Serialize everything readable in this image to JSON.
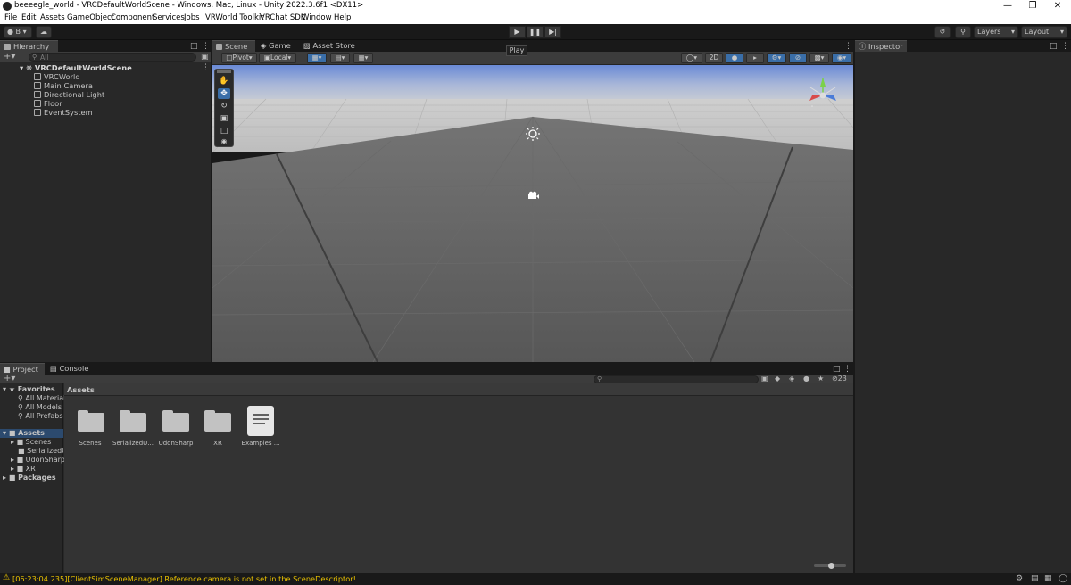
{
  "window": {
    "title": "beeeegle_world - VRCDefaultWorldScene - Windows, Mac, Linux - Unity 2022.3.6f1 <DX11>"
  },
  "menu": [
    "File",
    "Edit",
    "Assets",
    "GameObject",
    "Component",
    "Services",
    "Jobs",
    "VRWorld Toolkit",
    "VRChat SDK",
    "Window",
    "Help"
  ],
  "toolbar": {
    "account_label": "B",
    "play_tooltip": "Play",
    "layers_label": "Layers",
    "layout_label": "Layout"
  },
  "hierarchy": {
    "tab_label": "Hierarchy",
    "search_placeholder": "All",
    "scene_name": "VRCDefaultWorldScene",
    "items": [
      "VRCWorld",
      "Main Camera",
      "Directional Light",
      "Floor",
      "EventSystem"
    ]
  },
  "scene_tabs": [
    "Scene",
    "Game",
    "Asset Store"
  ],
  "scene_toolbar": {
    "pivot_label": "Pivot",
    "local_label": "Local",
    "mode_2d": "2D"
  },
  "inspector": {
    "tab_label": "Inspector"
  },
  "project": {
    "tabs": [
      "Project",
      "Console"
    ],
    "favorites_label": "Favorites",
    "favorites": [
      "All Materials",
      "All Models",
      "All Prefabs"
    ],
    "assets_label": "Assets",
    "asset_tree": [
      "Scenes",
      "SerializedUdonPrograms",
      "UdonSharp",
      "XR"
    ],
    "packages_label": "Packages",
    "breadcrumb": "Assets",
    "hidden_count": "23",
    "grid": [
      {
        "label": "Scenes",
        "kind": "folder"
      },
      {
        "label": "SerializedU...",
        "kind": "folder"
      },
      {
        "label": "UdonSharp",
        "kind": "folder"
      },
      {
        "label": "XR",
        "kind": "folder"
      },
      {
        "label": "Examples ...",
        "kind": "document"
      }
    ]
  },
  "status": {
    "message": "[06:23:04.235][ClientSimSceneManager] Reference camera is not set in the SceneDescriptor!"
  },
  "colors": {
    "accent": "#3a6ea8",
    "warning": "#e9c100",
    "panel": "#282828"
  }
}
